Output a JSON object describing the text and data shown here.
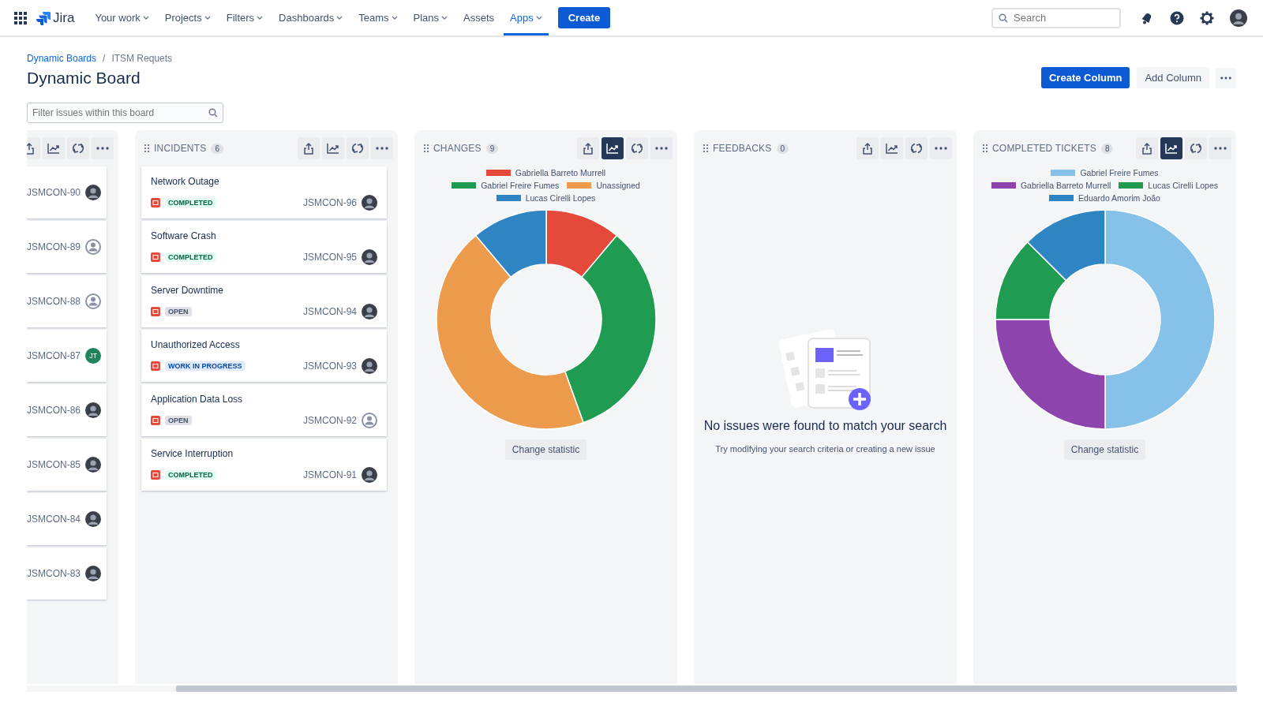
{
  "nav": {
    "product": "Jira",
    "items": [
      {
        "label": "Your work",
        "dropdown": true,
        "selected": false
      },
      {
        "label": "Projects",
        "dropdown": true,
        "selected": false
      },
      {
        "label": "Filters",
        "dropdown": true,
        "selected": false
      },
      {
        "label": "Dashboards",
        "dropdown": true,
        "selected": false
      },
      {
        "label": "Teams",
        "dropdown": true,
        "selected": false
      },
      {
        "label": "Plans",
        "dropdown": true,
        "selected": false
      },
      {
        "label": "Assets",
        "dropdown": false,
        "selected": false
      },
      {
        "label": "Apps",
        "dropdown": true,
        "selected": true
      }
    ],
    "create": "Create",
    "search": {
      "placeholder": "Search"
    }
  },
  "breadcrumbs": [
    "Dynamic Boards",
    "ITSM Requets"
  ],
  "breadcrumb_separator": "/",
  "title": "Dynamic Board",
  "actions": [
    {
      "label": "Create Column",
      "kind": "primary"
    },
    {
      "label": "Add Column",
      "kind": "secondary"
    }
  ],
  "filter": {
    "placeholder": "Filter issues within this board"
  },
  "columns": [
    {
      "kind": "list",
      "clipped": true,
      "chart_view": false,
      "cards": [
        {
          "key": "JSMCON-90",
          "avatar": {
            "kind": "photo"
          }
        },
        {
          "key": "JSMCON-89",
          "avatar": {
            "kind": "default"
          }
        },
        {
          "key": "JSMCON-88",
          "avatar": {
            "kind": "default"
          }
        },
        {
          "key": "JSMCON-87",
          "avatar": {
            "kind": "initials",
            "text": "JT"
          }
        },
        {
          "key": "JSMCON-86",
          "avatar": {
            "kind": "photo"
          }
        },
        {
          "key": "JSMCON-85",
          "avatar": {
            "kind": "photo"
          }
        },
        {
          "key": "JSMCON-84",
          "avatar": {
            "kind": "photo"
          }
        },
        {
          "key": "JSMCON-83",
          "avatar": {
            "kind": "photo"
          }
        }
      ]
    },
    {
      "kind": "list",
      "clipped": false,
      "title": "INCIDENTS",
      "count": "6",
      "chart_view": false,
      "cards": [
        {
          "title": "Network Outage",
          "status": "COMPLETED",
          "color": "#e3fcef",
          "key": "JSMCON-96",
          "avatar": {
            "kind": "photo"
          }
        },
        {
          "title": "Software Crash",
          "status": "COMPLETED",
          "color": "#e3fcef",
          "key": "JSMCON-95",
          "avatar": {
            "kind": "photo"
          }
        },
        {
          "title": "Server Downtime",
          "status": "OPEN",
          "color": "#dfe1e6",
          "key": "JSMCON-94",
          "avatar": {
            "kind": "photo"
          }
        },
        {
          "title": "Unauthorized Access",
          "status": "WORK IN PROGRESS",
          "color": "#deebff",
          "key": "JSMCON-93",
          "avatar": {
            "kind": "photo"
          }
        },
        {
          "title": "Application Data Loss",
          "status": "OPEN",
          "color": "#dfe1e6",
          "key": "JSMCON-92",
          "avatar": {
            "kind": "default"
          }
        },
        {
          "title": "Service Interruption",
          "status": "COMPLETED",
          "color": "#e3fcef",
          "key": "JSMCON-91",
          "avatar": {
            "kind": "photo"
          }
        }
      ]
    },
    {
      "kind": "chart",
      "clipped": false,
      "title": "CHANGES",
      "count": "9",
      "chart_view": true,
      "button": "Change statistic",
      "chart_data": {
        "type": "donut",
        "categories": [
          "Gabriella Barreto Murrell",
          "Gabriel Freire Fumes",
          "Unassigned",
          "Lucas Cirelli Lopes"
        ],
        "colors": [
          "#e5493a",
          "#1f9b52",
          "#ec9a4c",
          "#2f84c4"
        ],
        "values": [
          11.1,
          33.4,
          44.4,
          11.1
        ]
      }
    },
    {
      "kind": "empty",
      "clipped": false,
      "title": "FEEDBACKS",
      "count": "0",
      "chart_view": false,
      "empty": {
        "heading": "No issues were found to match your search",
        "text": "Try modifying your search criteria or creating a new issue"
      }
    },
    {
      "kind": "chart",
      "clipped": false,
      "title": "COMPLETED TICKETS",
      "count": "8",
      "chart_view": true,
      "button": "Change statistic",
      "chart_data": {
        "type": "donut",
        "categories": [
          "Gabriel Freire Fumes",
          "Gabriella Barreto Murrell",
          "Lucas Cirelli Lopes",
          "Eduardo Amorim João"
        ],
        "colors": [
          "#85c1e8",
          "#8e44ad",
          "#1f9b52",
          "#2f84c4"
        ],
        "values": [
          50,
          25,
          12.5,
          12.5
        ]
      }
    }
  ]
}
